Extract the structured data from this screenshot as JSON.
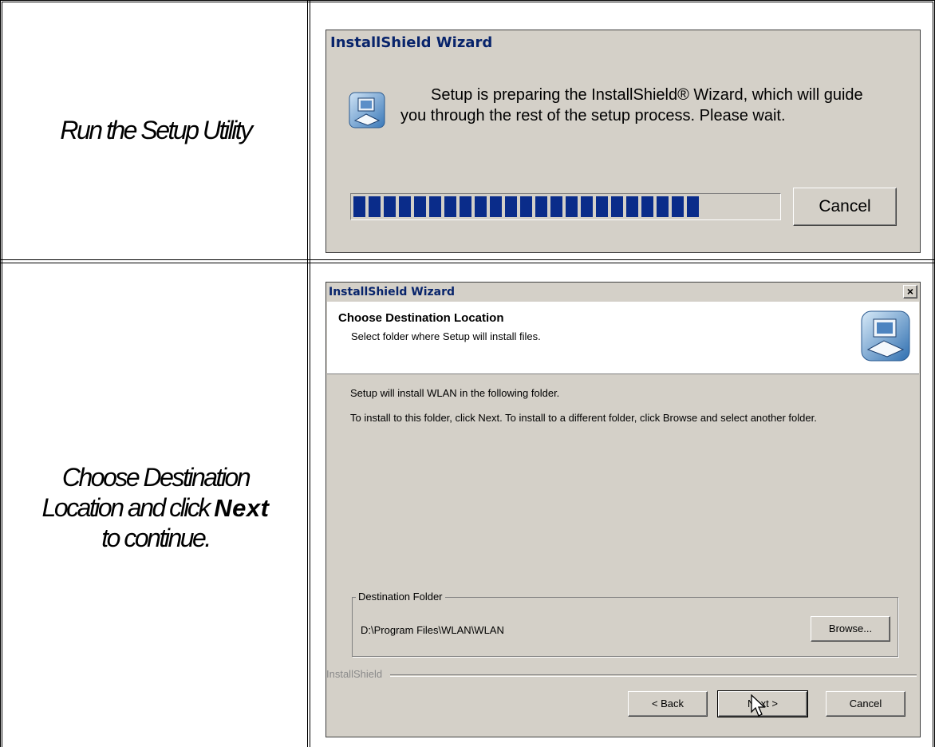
{
  "rows": [
    {
      "caption": "Run the Setup Utility",
      "dialog": {
        "title": "InstallShield Wizard",
        "message_line1": "Setup is preparing the InstallShield® Wizard, which will guide",
        "message_line2": "you through the rest of the setup process. Please wait.",
        "progress_fraction": 0.82,
        "cancel_label": "Cancel"
      }
    },
    {
      "caption_line1": "Choose Destination",
      "caption_line2": "Location and click ",
      "caption_bold": "Next",
      "caption_line3": "to continue.",
      "dialog": {
        "title": "InstallShield Wizard",
        "close_label": "×",
        "header_title": "Choose Destination Location",
        "header_subtitle": "Select folder where Setup will install files.",
        "body_line1": "Setup will install WLAN in the following folder.",
        "body_line2": "To install to this folder, click Next. To install to a different folder, click Browse and select another folder.",
        "group_label": "Destination Folder",
        "destination_path": "D:\\Program Files\\WLAN\\WLAN",
        "browse_label": "Browse...",
        "brand_label": "InstallShield",
        "back_label": "< Back",
        "next_label": "Next >",
        "cancel_label": "Cancel"
      }
    }
  ],
  "icons": {
    "setup_icon": "installshield-computer-icon",
    "cursor": "mouse-pointer-icon"
  },
  "colors": {
    "dialog_bg": "#d4d0c8",
    "title_text": "#08246b",
    "progress_fill": "#0a2c8a"
  }
}
